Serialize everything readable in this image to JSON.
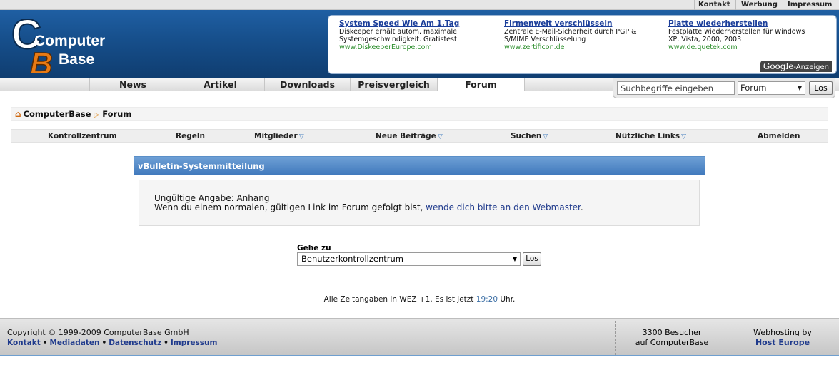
{
  "top_links": [
    "Kontakt",
    "Werbung",
    "Impressum"
  ],
  "logo": {
    "line1": "Computer",
    "line2": "Base"
  },
  "ads": [
    {
      "title": "System Speed Wie Am 1.Tag",
      "line1": "Diskeeper erhält autom. maximale",
      "line2": "Systemgeschwindigkeit. Gratistest!",
      "url": "www.DiskeeperEurope.com"
    },
    {
      "title": "Firmenweit verschlüsseln",
      "line1": "Zentrale E-Mail-Sicherheit durch PGP &",
      "line2": "S/MIME Verschlüsselung",
      "url": "www.zertificon.de"
    },
    {
      "title": "Platte wiederherstellen",
      "line1": "Festplatte wiederherstellen für Windows",
      "line2": "XP, Vista, 2000, 2003",
      "url": "www.de.quetek.com"
    }
  ],
  "google_label": {
    "brand": "Google",
    "suffix": "-Anzeigen"
  },
  "nav": [
    "News",
    "Artikel",
    "Downloads",
    "Preisvergleich",
    "Forum"
  ],
  "nav_active": "Forum",
  "search": {
    "placeholder": "Suchbegriffe eingeben",
    "scope": "Forum",
    "button": "Los"
  },
  "breadcrumb": [
    "ComputerBase",
    "Forum"
  ],
  "member_nav": [
    "Kontrollzentrum",
    "Regeln",
    "Mitglieder",
    "Neue Beiträge",
    "Suchen",
    "Nützliche Links",
    "Abmelden"
  ],
  "message": {
    "title": "vBulletin-Systemmitteilung",
    "line1": "Ungültige Angabe: Anhang",
    "line2_prefix": "Wenn du einem normalen, gültigen Link im Forum gefolgt bist, ",
    "line2_link": "wende dich bitte an den Webmaster",
    "line2_suffix": "."
  },
  "jump": {
    "label": "Gehe zu",
    "selected": "Benutzerkontrollzentrum",
    "button": "Los"
  },
  "time_info": {
    "prefix": "Alle Zeitangaben in WEZ +1. Es ist jetzt ",
    "time": "19:20",
    "suffix": " Uhr."
  },
  "footer": {
    "copyright": "Copyright © 1999-2009 ComputerBase GmbH",
    "links": [
      "Kontakt",
      "Mediadaten",
      "Datenschutz",
      "Impressum"
    ],
    "visitors_line1": "3300 Besucher",
    "visitors_line2": "auf ComputerBase",
    "hosting_label": "Webhosting by",
    "hosting_link": "Host Europe"
  },
  "colors": {
    "header_blue": "#17508d",
    "panel_blue": "#3f78bc",
    "link": "#1f3a8c",
    "ad_url": "#2a8d2a"
  }
}
